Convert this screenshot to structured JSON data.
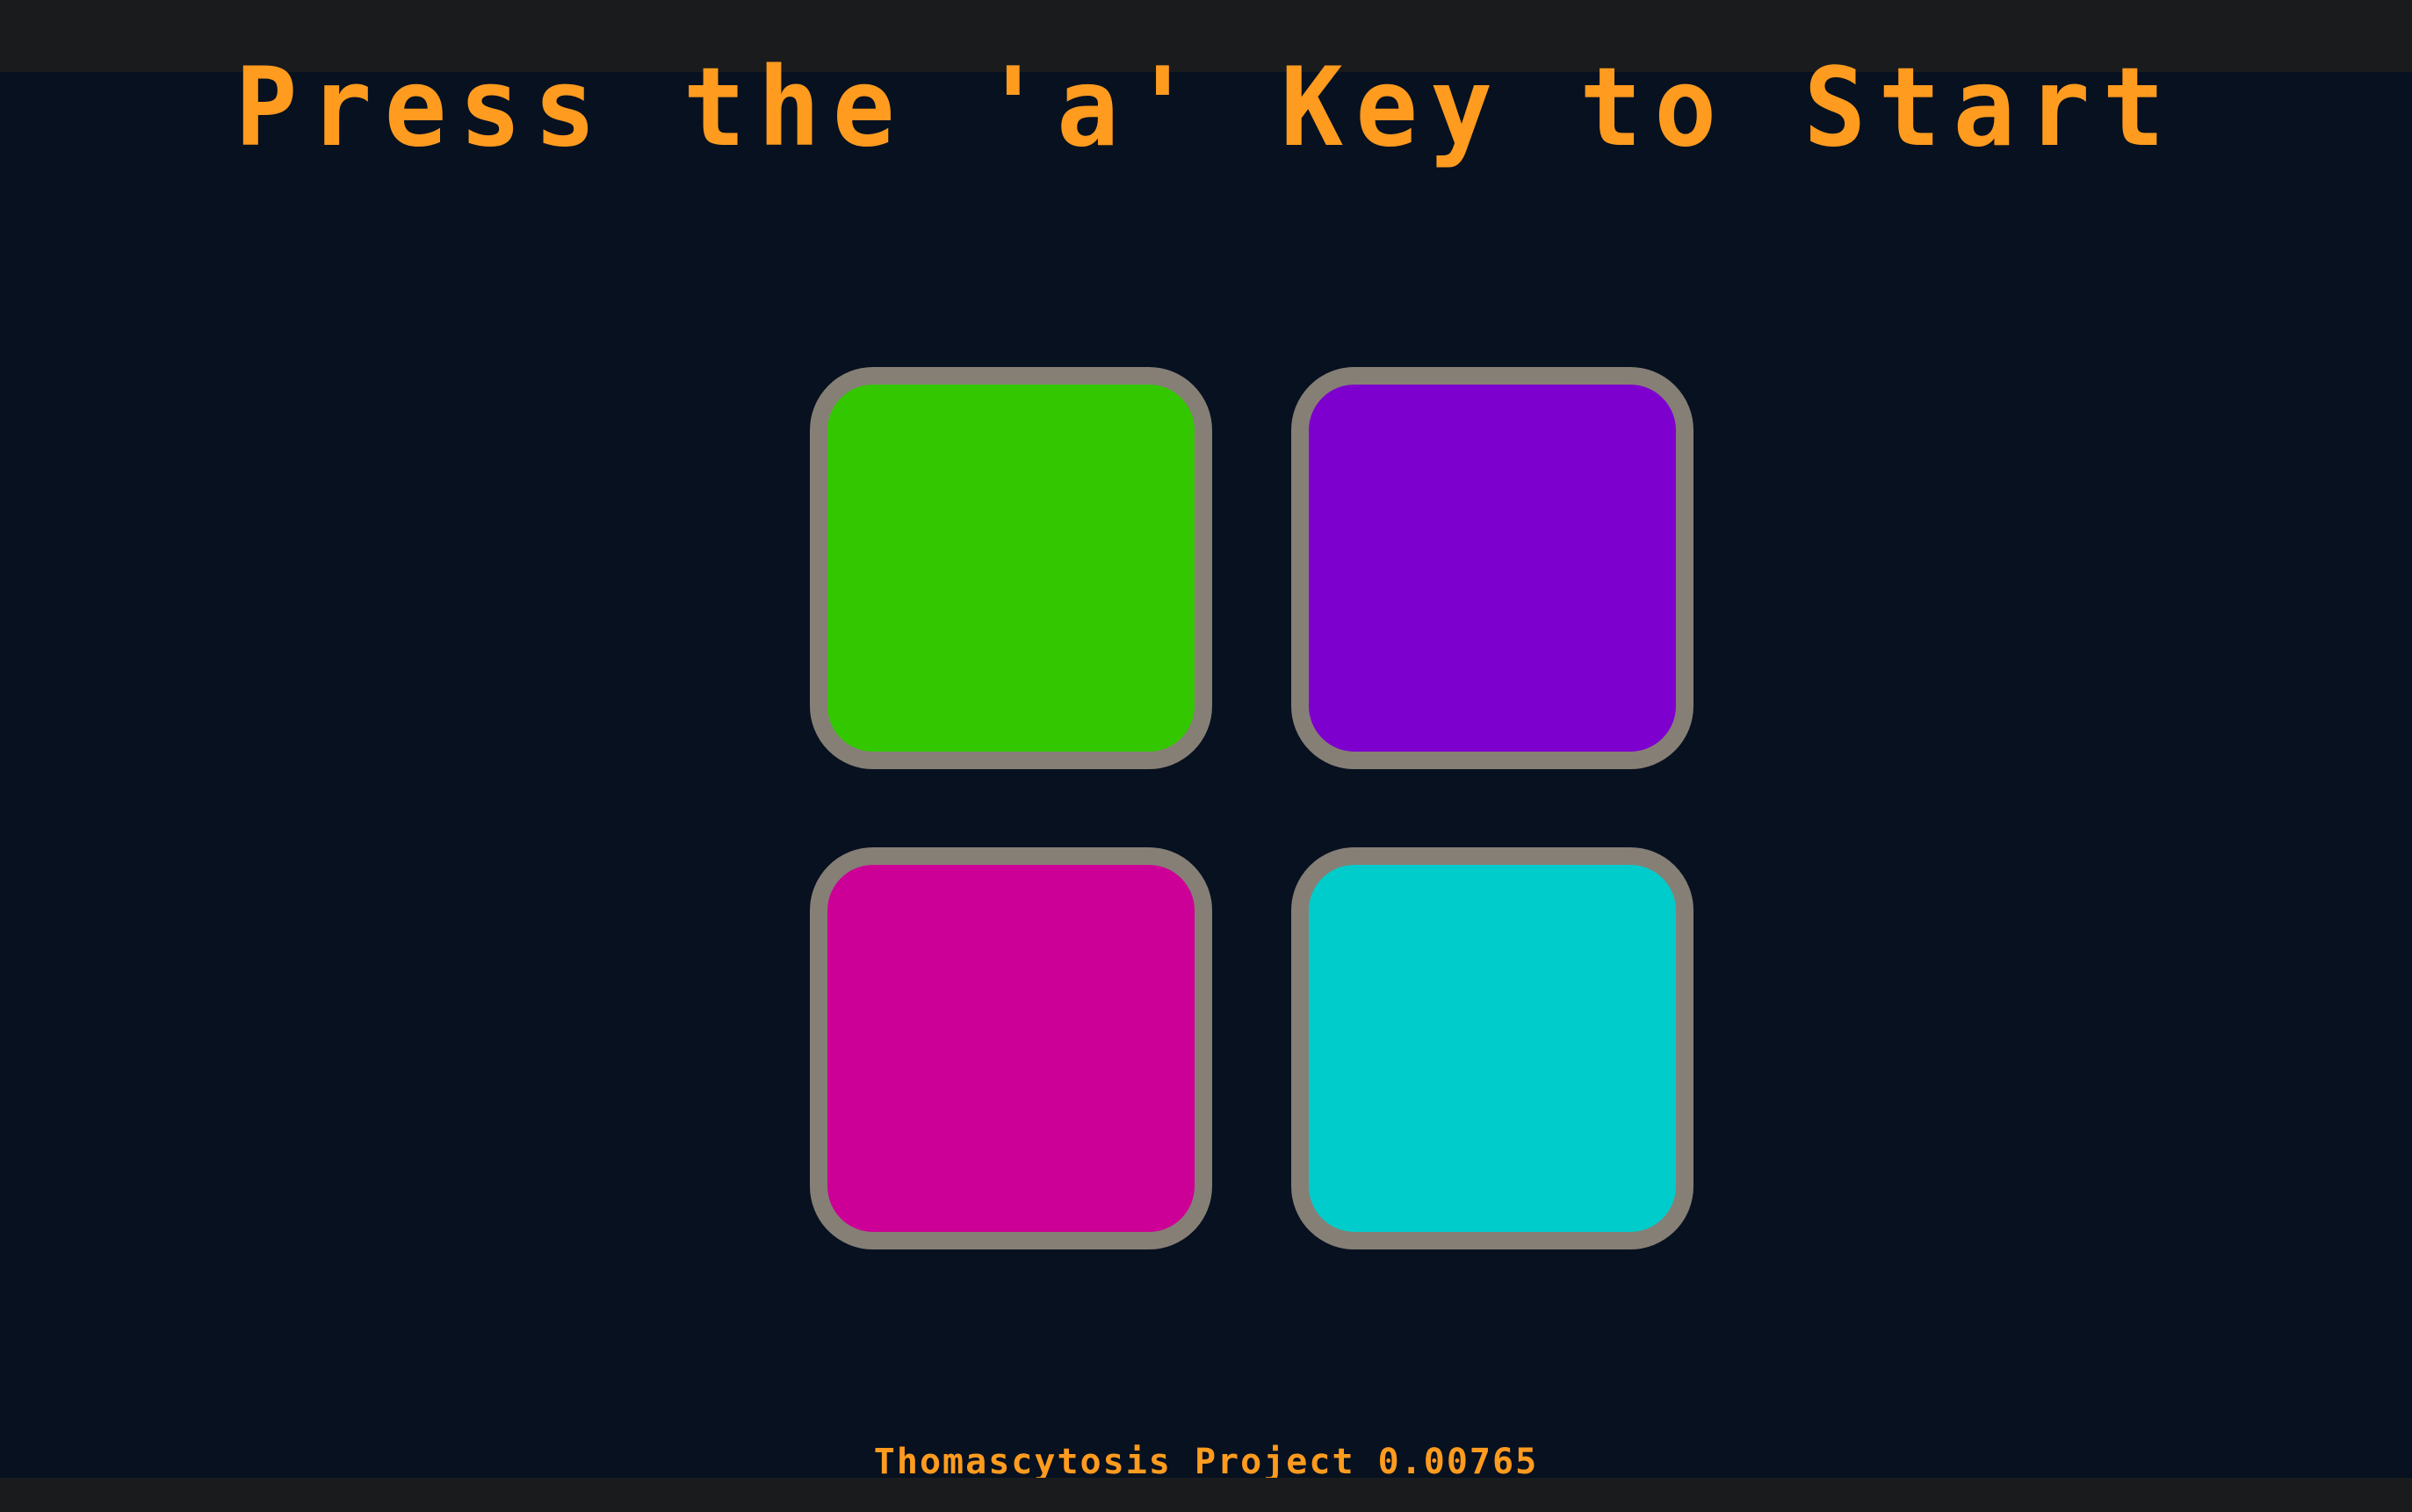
{
  "title": "Press the 'a' Key to Start",
  "footer": "Thomascytosis Project 0.00765",
  "colors": {
    "background": "#071120",
    "frame_bars": "#1a1b1d",
    "text": "#ff9b1e",
    "pad_border": "#867f76",
    "pad_green": "#33c700",
    "pad_purple": "#7e00cf",
    "pad_magenta": "#cc0096",
    "pad_cyan": "#00cccb"
  },
  "pads": [
    {
      "name": "green",
      "color": "#33c700"
    },
    {
      "name": "purple",
      "color": "#7e00cf"
    },
    {
      "name": "magenta",
      "color": "#cc0096"
    },
    {
      "name": "cyan",
      "color": "#00cccb"
    }
  ]
}
